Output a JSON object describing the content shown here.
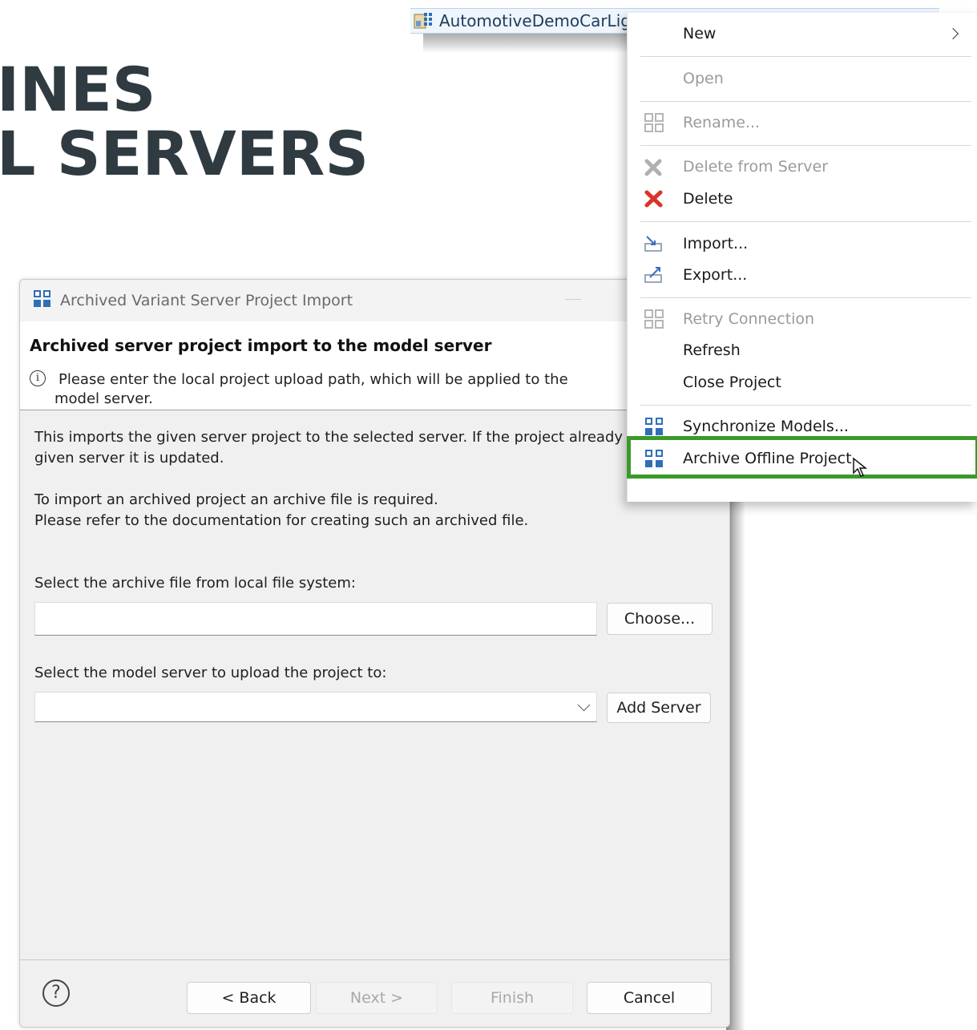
{
  "headline": {
    "line1": "INES",
    "line2": "L SERVERS"
  },
  "tree": {
    "item_label": "AutomotiveDemoCarLig"
  },
  "dialog": {
    "title": "Archived Variant Server Project Import",
    "heading": "Archived server project import to the model server",
    "info_line1": "Please enter the local project upload path, which will be applied to the",
    "info_line2": "model server.",
    "body_line1": "This imports the given server project to the selected server. If the project already e",
    "body_line2": "given server it is updated.",
    "body_line3": "To import an archived project an archive file is required.",
    "body_line4": "Please refer to the documentation for creating such an archived file.",
    "archive_label": "Select the archive file from local file system:",
    "archive_value": "",
    "choose_button": "Choose...",
    "server_label": "Select the model server to upload the project to:",
    "server_value": "",
    "add_server_button": "Add Server",
    "help_glyph": "?",
    "back_button": "< Back",
    "next_button": "Next >",
    "finish_button": "Finish",
    "cancel_button": "Cancel"
  },
  "context_menu": {
    "items": [
      {
        "label": "New",
        "enabled": true,
        "submenu": true
      },
      {
        "label": "Open",
        "enabled": false
      },
      {
        "label": "Rename...",
        "enabled": false,
        "icon": "grid-icon"
      },
      {
        "label": "Delete from Server",
        "enabled": false,
        "icon": "delete-icon"
      },
      {
        "label": "Delete",
        "enabled": true,
        "icon": "delete-icon"
      },
      {
        "label": "Import...",
        "enabled": true,
        "icon": "import-icon"
      },
      {
        "label": "Export...",
        "enabled": true,
        "icon": "export-icon"
      },
      {
        "label": "Retry Connection",
        "enabled": false,
        "icon": "grid-icon"
      },
      {
        "label": "Refresh",
        "enabled": true
      },
      {
        "label": "Close Project",
        "enabled": true
      },
      {
        "label": "Synchronize Models...",
        "enabled": true,
        "icon": "grid-icon"
      },
      {
        "label": "Archive Offline Project",
        "enabled": true,
        "icon": "grid-icon",
        "highlighted": true
      }
    ]
  },
  "colors": {
    "highlight": "#3a9a2a",
    "accent_blue": "#2f6fb5",
    "delete_red": "#d9342b",
    "headline": "#2f3b40"
  }
}
